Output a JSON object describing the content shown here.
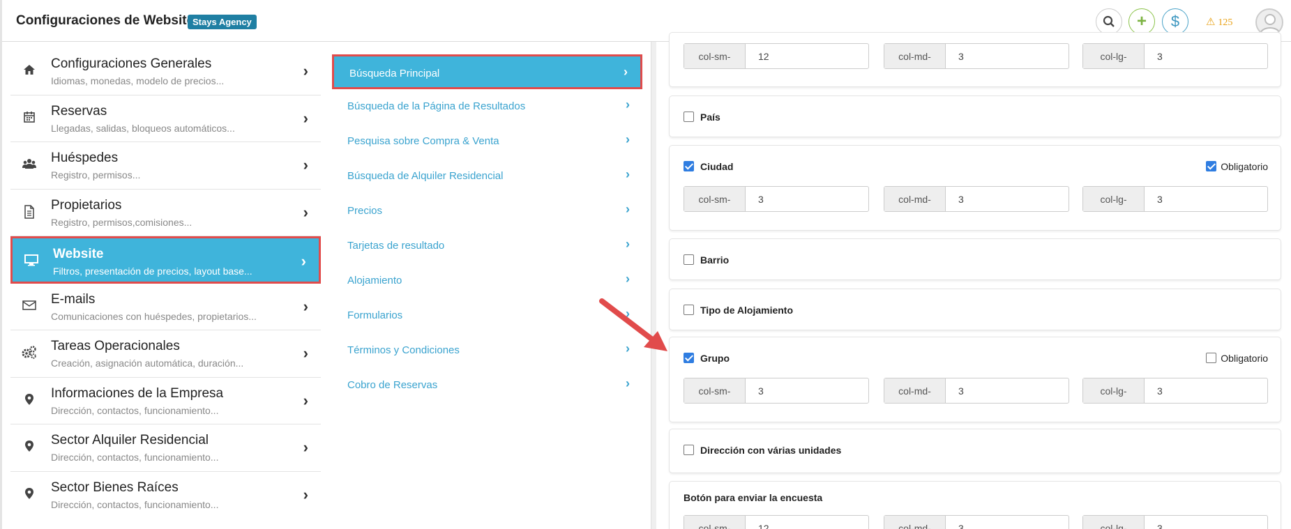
{
  "header": {
    "title": "Configuraciones de Website",
    "badge": "Stays Agency",
    "alert_count": "125"
  },
  "left_menu": [
    {
      "title": "Configuraciones Generales",
      "subtitle": "Idiomas, monedas, modelo de precios...",
      "icon": "home-icon"
    },
    {
      "title": "Reservas",
      "subtitle": "Llegadas, salidas, bloqueos automáticos...",
      "icon": "calendar-icon"
    },
    {
      "title": "Huéspedes",
      "subtitle": "Registro, permisos...",
      "icon": "users-icon"
    },
    {
      "title": "Propietarios",
      "subtitle": "Registro, permisos,comisiones...",
      "icon": "document-icon"
    },
    {
      "title": "Website",
      "subtitle": "Filtros, presentación de precios, layout base...",
      "icon": "monitor-icon",
      "active": true
    },
    {
      "title": "E-mails",
      "subtitle": "Comunicaciones con huéspedes, propietarios...",
      "icon": "envelope-icon"
    },
    {
      "title": "Tareas Operacionales",
      "subtitle": "Creación, asignación automática, duración...",
      "icon": "gears-icon"
    },
    {
      "title": "Informaciones de la Empresa",
      "subtitle": "Dirección, contactos, funcionamiento...",
      "icon": "map-pin-icon"
    },
    {
      "title": "Sector Alquiler Residencial",
      "subtitle": "Dirección, contactos, funcionamiento...",
      "icon": "map-pin-icon"
    },
    {
      "title": "Sector Bienes Raíces",
      "subtitle": "Dirección, contactos, funcionamiento...",
      "icon": "map-pin-icon"
    }
  ],
  "mid_menu": [
    {
      "label": "Búsqueda Principal",
      "active": true
    },
    {
      "label": "Búsqueda de la Página de Resultados"
    },
    {
      "label": "Pesquisa sobre Compra & Venta"
    },
    {
      "label": "Búsqueda de Alquiler Residencial"
    },
    {
      "label": "Precios"
    },
    {
      "label": "Tarjetas de resultado"
    },
    {
      "label": "Alojamiento"
    },
    {
      "label": "Formularios"
    },
    {
      "label": "Términos y Condiciones"
    },
    {
      "label": "Cobro de Reservas"
    }
  ],
  "fields": {
    "addon_sm": "col-sm-",
    "addon_md": "col-md-",
    "addon_lg": "col-lg-",
    "obligatorio": "Obligatorio",
    "top": {
      "sm": "12",
      "md": "3",
      "lg": "3"
    },
    "pais": {
      "label": "País",
      "checked": false
    },
    "ciudad": {
      "label": "Ciudad",
      "checked": true,
      "obligatorio": true,
      "sm": "3",
      "md": "3",
      "lg": "3"
    },
    "barrio": {
      "label": "Barrio",
      "checked": false
    },
    "tipo": {
      "label": "Tipo de Alojamiento",
      "checked": false
    },
    "grupo": {
      "label": "Grupo",
      "checked": true,
      "obligatorio": false,
      "sm": "3",
      "md": "3",
      "lg": "3"
    },
    "direccion": {
      "label": "Dirección con várias unidades",
      "checked": false
    },
    "boton": {
      "label": "Botón para enviar la encuesta",
      "sm": "12",
      "md": "3",
      "lg": "3"
    }
  },
  "colors": {
    "accent": "#3fb4db",
    "highlight_border": "#e14b4b",
    "checkbox": "#2f7de1",
    "link": "#3aa3cf"
  }
}
